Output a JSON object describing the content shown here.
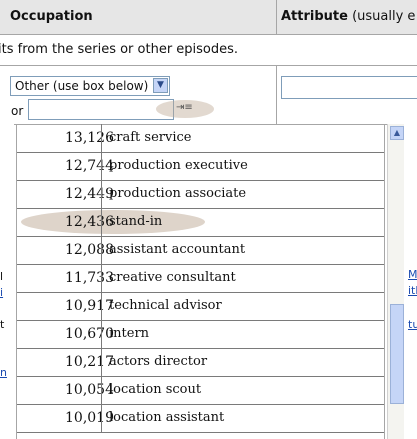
{
  "header": {
    "occupation_label": "Occupation",
    "attribute_label": "Attribute",
    "attribute_suffix": " (usually e"
  },
  "note": "its from the series or other episodes.",
  "form": {
    "select_value": "Other (use box below)",
    "or_label": "or",
    "hint_glyph": "⇥≡"
  },
  "occupations": [
    {
      "count": "13,126",
      "name": "craft service"
    },
    {
      "count": "12,744",
      "name": "production executive"
    },
    {
      "count": "12,449",
      "name": "production associate"
    },
    {
      "count": "12,436",
      "name": "stand-in"
    },
    {
      "count": "12,088",
      "name": "assistant accountant"
    },
    {
      "count": "11,733",
      "name": "creative consultant"
    },
    {
      "count": "10,917",
      "name": "technical advisor"
    },
    {
      "count": "10,670",
      "name": "intern"
    },
    {
      "count": "10,217",
      "name": "actors director"
    },
    {
      "count": "10,054",
      "name": "location scout"
    },
    {
      "count": "10,019",
      "name": "location assistant"
    }
  ],
  "left_fragments": [
    "l",
    "i",
    "t",
    "n"
  ],
  "right_fragments": [
    "M",
    "ith",
    "tu"
  ]
}
